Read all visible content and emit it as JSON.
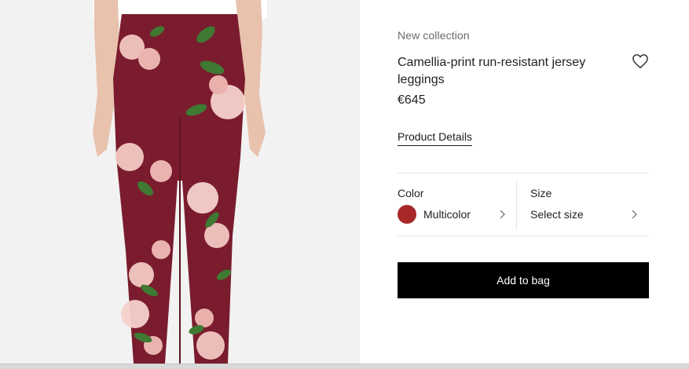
{
  "product": {
    "collection": "New collection",
    "title": "Camellia-print run-resistant jersey leggings",
    "price": "€645",
    "details_link": "Product Details"
  },
  "color": {
    "label": "Color",
    "value": "Multicolor",
    "swatch": "#a8282a"
  },
  "size": {
    "label": "Size",
    "value": "Select size"
  },
  "actions": {
    "add_to_bag": "Add to bag"
  },
  "icons": {
    "wishlist": "heart-icon",
    "chevron": "chevron-right-icon"
  },
  "colors": {
    "legging_base": "#7a1c2e",
    "button_bg": "#000000",
    "image_bg": "#f2f2f2"
  }
}
